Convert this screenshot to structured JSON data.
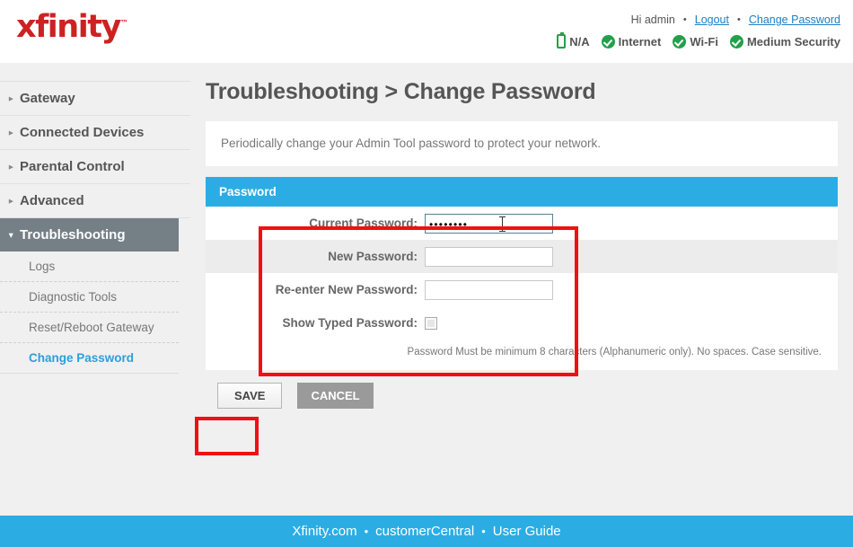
{
  "header": {
    "logo": "xfinity",
    "logo_tm": "™",
    "greeting": "Hi admin",
    "bullet": "•",
    "logout_label": "Logout",
    "change_password_label": "Change Password",
    "status": [
      {
        "icon": "battery-icon",
        "label": "N/A"
      },
      {
        "icon": "check-circle-icon",
        "label": "Internet"
      },
      {
        "icon": "check-circle-icon",
        "label": "Wi-Fi"
      },
      {
        "icon": "check-circle-icon",
        "label": "Medium Security"
      }
    ]
  },
  "sidebar": {
    "top_items": [
      {
        "label": "Gateway",
        "arrow": "▸",
        "active": false
      },
      {
        "label": "Connected Devices",
        "arrow": "▸",
        "active": false
      },
      {
        "label": "Parental Control",
        "arrow": "▸",
        "active": false
      },
      {
        "label": "Advanced",
        "arrow": "▸",
        "active": false
      },
      {
        "label": "Troubleshooting",
        "arrow": "▾",
        "active": true
      }
    ],
    "sub_items": [
      {
        "label": "Logs",
        "current": false
      },
      {
        "label": "Diagnostic Tools",
        "current": false
      },
      {
        "label": "Reset/Reboot Gateway",
        "current": false
      },
      {
        "label": "Change Password",
        "current": true
      }
    ]
  },
  "main": {
    "page_title": "Troubleshooting > Change Password",
    "description": "Periodically change your Admin Tool password to protect your network.",
    "panel_title": "Password",
    "fields": [
      {
        "label": "Current Password:",
        "value": "••••••••",
        "placeholder": "",
        "focused": true
      },
      {
        "label": "New Password:",
        "value": "",
        "placeholder": "",
        "focused": false
      },
      {
        "label": "Re-enter New Password:",
        "value": "",
        "placeholder": "",
        "focused": false
      }
    ],
    "checkbox_label": "Show Typed Password:",
    "checkbox_checked": false,
    "hint": "Password Must be minimum 8 characters (Alphanumeric only). No spaces. Case sensitive.",
    "save_label": "SAVE",
    "cancel_label": "CANCEL"
  },
  "footer": {
    "links": [
      "Xfinity.com",
      "customerCentral",
      "User Guide"
    ],
    "separator": "•"
  },
  "colors": {
    "brand_red": "#cc2222",
    "accent_blue": "#2bade4",
    "link_blue": "#1b7fc4",
    "status_green": "#22a04a",
    "annotation_red": "#ee1111",
    "sidebar_active": "#757f86"
  }
}
